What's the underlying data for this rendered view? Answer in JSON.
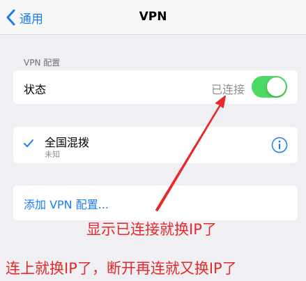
{
  "navbar": {
    "back_label": "通用",
    "title": "VPN"
  },
  "section": {
    "header": "VPN 配置"
  },
  "status_row": {
    "label": "状态",
    "value": "已连接",
    "toggle_on": true
  },
  "vpn_row": {
    "name": "全国混拨",
    "subtitle": "未知",
    "selected": true
  },
  "add_row": {
    "label": "添加 VPN 配置..."
  },
  "annotations": {
    "arrow_label": "显示已连接就换IP了",
    "bottom_note": "连上就换IP了，断开再连就又换IP了"
  },
  "colors": {
    "accent": "#1a7cf2",
    "toggle_on": "#4cd964",
    "annotation": "#e62a2a",
    "background": "#efeff4"
  },
  "icons": {
    "back": "chevron-left-icon",
    "check": "checkmark-icon",
    "info": "info-circle-icon",
    "arrow": "red-arrow"
  }
}
